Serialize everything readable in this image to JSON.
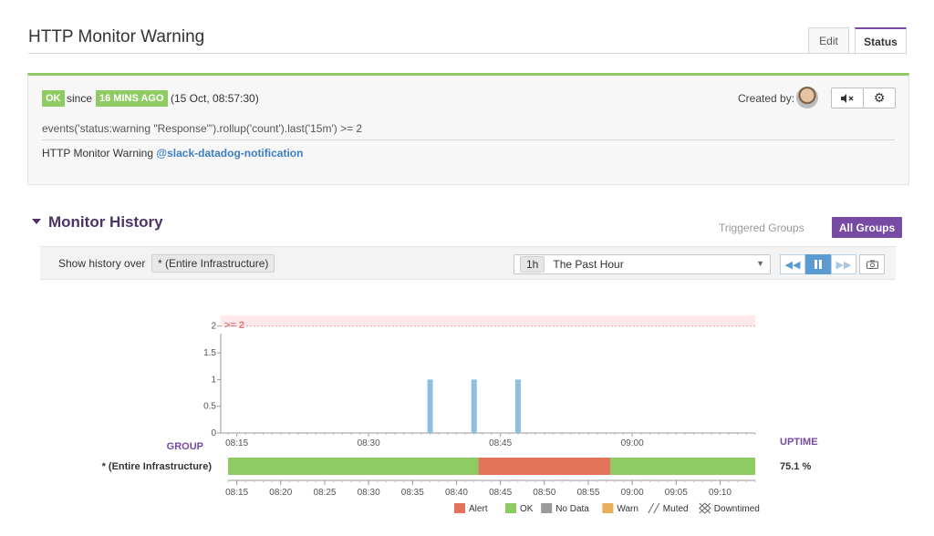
{
  "page": {
    "title": "HTTP Monitor Warning"
  },
  "tabs": {
    "edit": "Edit",
    "status": "Status"
  },
  "status": {
    "state_badge": "OK",
    "since_label": "since",
    "duration_badge": "16 MINS AGO",
    "since_time": "(15 Oct, 08:57:30)",
    "created_by_label": "Created by:",
    "mute_icon": "mute-icon",
    "settings_icon": "gear-icon",
    "query": "events('status:warning \"Response\"').rollup('count').last('15m') >= 2",
    "message_prefix": "HTTP Monitor Warning",
    "message_mention": "@slack-datadog-notification",
    "ok_color": "#8fcb63"
  },
  "history": {
    "title": "Monitor History",
    "triggered_groups": "Triggered Groups",
    "all_groups": "All Groups",
    "show_history_label": "Show history over",
    "scope": "* (Entire Infrastructure)",
    "timeframe_short": "1h",
    "timeframe_label": "The Past Hour"
  },
  "chart_data": {
    "type": "bar",
    "threshold": {
      "label": ">= 2",
      "value": 2,
      "color": "#fde8ea"
    },
    "y_ticks": [
      "0",
      "0.5",
      "1",
      "1.5",
      "2"
    ],
    "ylim": [
      0,
      2.2
    ],
    "x_ticks": [
      "08:15",
      "08:30",
      "08:45",
      "09:00"
    ],
    "xlim": [
      "08:14",
      "09:14"
    ],
    "bars": [
      {
        "time": "08:37",
        "value": 1
      },
      {
        "time": "08:42",
        "value": 1
      },
      {
        "time": "08:47",
        "value": 1
      }
    ],
    "bar_color": "#8fbfde"
  },
  "group_timeline": {
    "group_header": "GROUP",
    "uptime_header": "UPTIME",
    "group_name": "* (Entire Infrastructure)",
    "uptime": "75.1 %",
    "segments": [
      {
        "state": "OK",
        "start": "08:14",
        "end": "08:42.5"
      },
      {
        "state": "Alert",
        "start": "08:42.5",
        "end": "08:57.5"
      },
      {
        "state": "OK",
        "start": "08:57.5",
        "end": "09:14"
      }
    ],
    "ticks": [
      "08:15",
      "08:20",
      "08:25",
      "08:30",
      "08:35",
      "08:40",
      "08:45",
      "08:50",
      "08:55",
      "09:00",
      "09:05",
      "09:10"
    ]
  },
  "legend": [
    {
      "label": "Alert",
      "color": "#e4735b",
      "pattern": "solid"
    },
    {
      "label": "OK",
      "color": "#8fcb63",
      "pattern": "solid"
    },
    {
      "label": "No Data",
      "color": "#9a9a9a",
      "pattern": "solid"
    },
    {
      "label": "Warn",
      "color": "#e9b05b",
      "pattern": "solid"
    },
    {
      "label": "Muted",
      "color": "#666666",
      "pattern": "hatch"
    },
    {
      "label": "Downtimed",
      "color": "#666666",
      "pattern": "cross"
    }
  ]
}
